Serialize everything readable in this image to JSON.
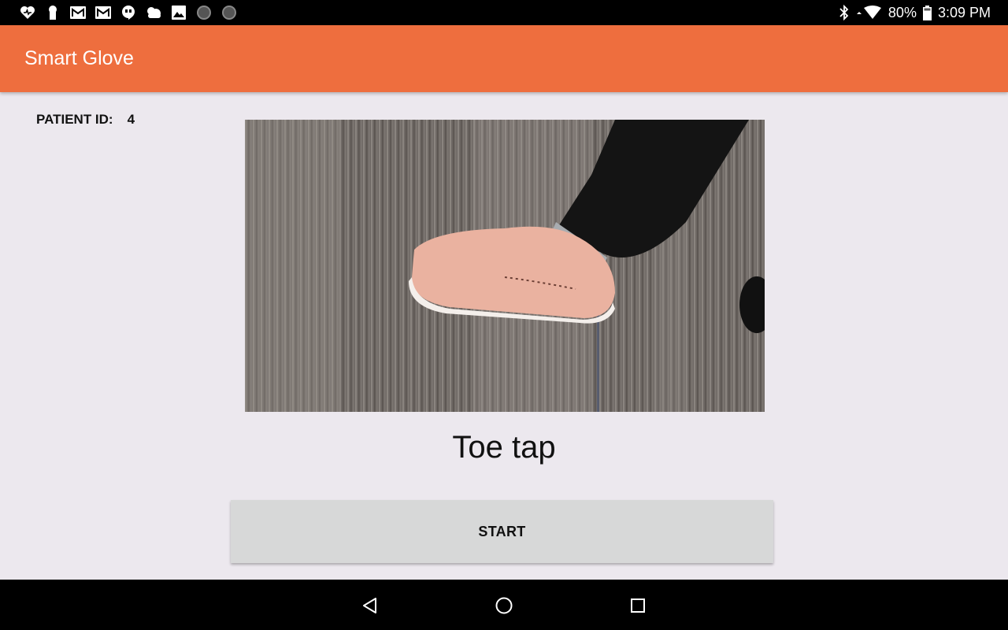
{
  "status_bar": {
    "notification_icons": [
      "heart-icon",
      "keyhole-icon",
      "gmail-icon",
      "gmail-icon",
      "hangouts-icon",
      "weather-icon",
      "gallery-icon",
      "circle-icon",
      "circle-icon"
    ],
    "battery": "80%",
    "time": "3:09 PM"
  },
  "app_bar": {
    "title": "Smart Glove",
    "color": "#EE6E3E"
  },
  "patient": {
    "label": "PATIENT ID:",
    "id": "4"
  },
  "exercise": {
    "name": "Toe tap"
  },
  "start_button": {
    "label": "START"
  },
  "nav_bar": {
    "items": [
      "back-icon",
      "home-icon",
      "recents-icon"
    ]
  }
}
